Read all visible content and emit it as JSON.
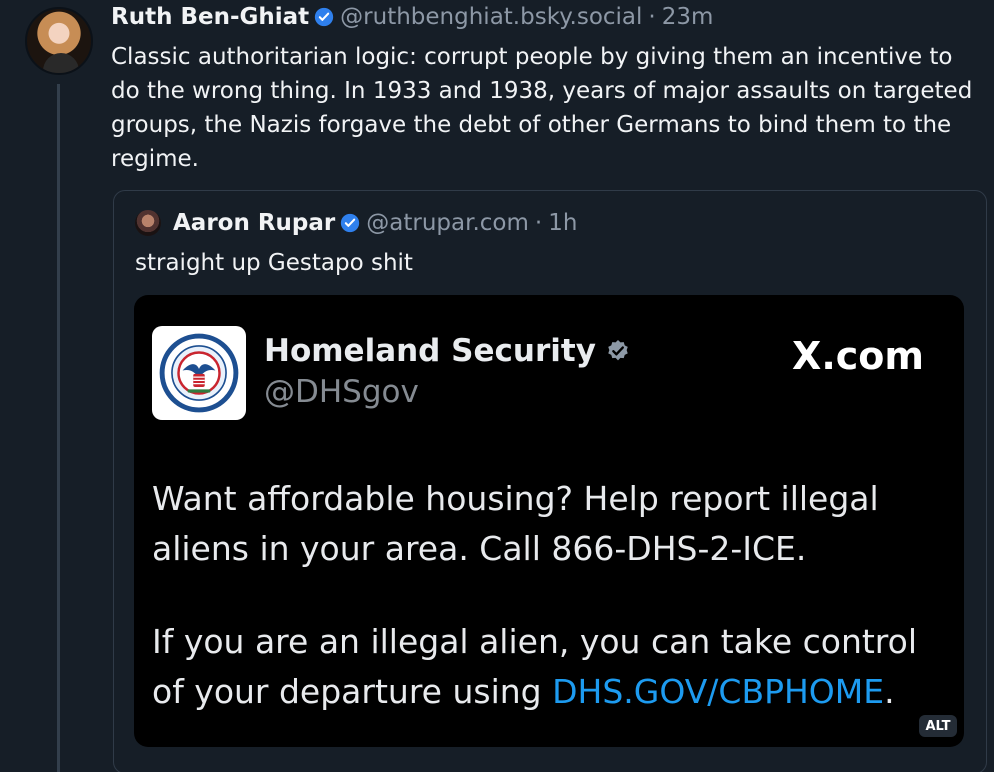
{
  "post": {
    "author": {
      "display_name": "Ruth Ben-Ghiat",
      "handle": "@ruthbenghiat.bsky.social",
      "separator": "·",
      "time": "23m",
      "avatar_icon": "person-avatar",
      "verified_icon": "verified-check"
    },
    "text": "Classic authoritarian logic: corrupt people by giving them an incentive to do the wrong thing. In 1933 and 1938, years of major assaults on targeted groups, the Nazis forgave the debt of other Germans to bind them to the regime."
  },
  "quoted_post": {
    "author": {
      "display_name": "Aaron Rupar",
      "handle": "@atrupar.com",
      "separator": "·",
      "time": "1h",
      "avatar_icon": "person-avatar",
      "verified_icon": "verified-check"
    },
    "text": "straight up Gestapo shit",
    "embedded_image": {
      "account_name": "Homeland Security",
      "account_handle": "@DHSgov",
      "site_label": "X.com",
      "message_part1": "Want affordable housing? Help report illegal aliens in your area. Call 866-DHS-2-ICE.",
      "message_part2_before_link": "If you are an illegal alien, you can take control of your departure using ",
      "message_link": "DHS.GOV/CBPHOME",
      "message_part2_after_link": ".",
      "alt_badge": "ALT",
      "logo_icon": "dhs-seal"
    }
  },
  "colors": {
    "background": "#161e27",
    "text": "#f1f3f5",
    "muted_text": "#8d98a6",
    "accent": "#2f80ed",
    "link": "#1d9bf0",
    "image_background": "#000000"
  }
}
